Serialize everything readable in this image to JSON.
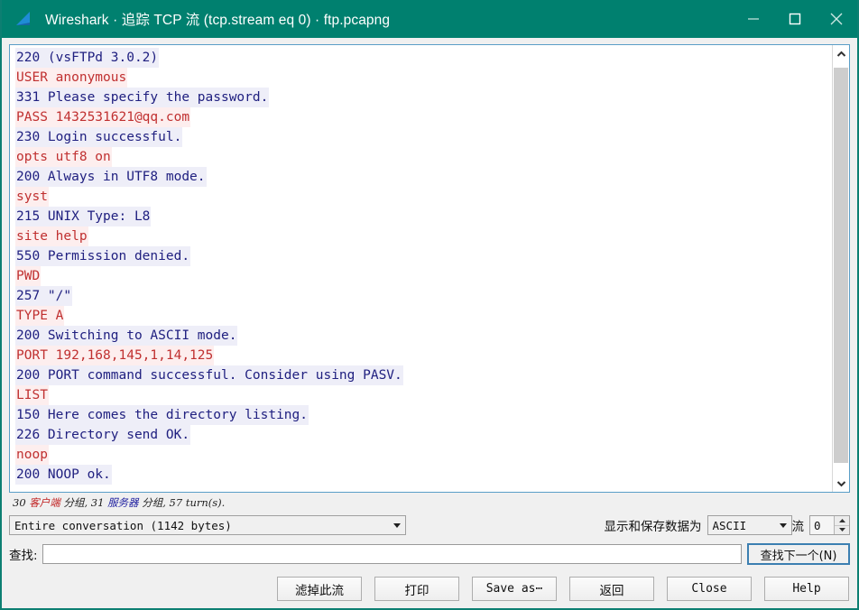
{
  "window": {
    "title": "Wireshark · 追踪 TCP 流 (tcp.stream eq 0) · ftp.pcapng",
    "titlebar_color": "#00806f",
    "minimize_label": "—",
    "maximize_label": "□",
    "close_label": "✕",
    "logo_icon": "wireshark-fin-icon"
  },
  "stream": {
    "lines": [
      {
        "side": "server",
        "text": "220 (vsFTPd 3.0.2)"
      },
      {
        "side": "client",
        "text": "USER anonymous"
      },
      {
        "side": "server",
        "text": "331 Please specify the password."
      },
      {
        "side": "client",
        "text": "PASS 1432531621@qq.com"
      },
      {
        "side": "server",
        "text": "230 Login successful."
      },
      {
        "side": "client",
        "text": "opts utf8 on"
      },
      {
        "side": "server",
        "text": "200 Always in UTF8 mode."
      },
      {
        "side": "client",
        "text": "syst"
      },
      {
        "side": "server",
        "text": "215 UNIX Type: L8"
      },
      {
        "side": "client",
        "text": "site help"
      },
      {
        "side": "server",
        "text": "550 Permission denied."
      },
      {
        "side": "client",
        "text": "PWD"
      },
      {
        "side": "server",
        "text": "257 \"/\""
      },
      {
        "side": "client",
        "text": "TYPE A"
      },
      {
        "side": "server",
        "text": "200 Switching to ASCII mode."
      },
      {
        "side": "client",
        "text": "PORT 192,168,145,1,14,125"
      },
      {
        "side": "server",
        "text": "200 PORT command successful. Consider using PASV."
      },
      {
        "side": "client",
        "text": "LIST"
      },
      {
        "side": "server",
        "text": "150 Here comes the directory listing."
      },
      {
        "side": "server",
        "text": "226 Directory send OK."
      },
      {
        "side": "client",
        "text": "noop"
      },
      {
        "side": "server",
        "text": "200 NOOP ok."
      }
    ],
    "client_color": "#c03030",
    "server_color": "#202080"
  },
  "status": {
    "client_packets_count": "30",
    "client_word": "客户端",
    "client_packets_unit": "分组,",
    "server_packets_count": "31",
    "server_word": "服务器",
    "server_packets_unit": "分组,",
    "turns": "57 turn(s)."
  },
  "controls": {
    "conversation_value": "Entire conversation (1142 bytes)",
    "show_save_label": "显示和保存数据为",
    "encoding_value": "ASCII",
    "stream_label": "流",
    "stream_value": "0",
    "find_label": "查找:",
    "find_value": "",
    "find_placeholder": "",
    "find_next_label": "查找下一个(N)"
  },
  "buttons": [
    {
      "label": "滤掉此流",
      "cjk": true,
      "name": "filter-out-this-stream-button"
    },
    {
      "label": "打印",
      "cjk": true,
      "name": "print-button"
    },
    {
      "label": "Save as⋯",
      "cjk": false,
      "name": "save-as-button"
    },
    {
      "label": "返回",
      "cjk": true,
      "name": "back-button"
    },
    {
      "label": "Close",
      "cjk": false,
      "name": "close-button"
    },
    {
      "label": "Help",
      "cjk": false,
      "name": "help-button"
    }
  ]
}
